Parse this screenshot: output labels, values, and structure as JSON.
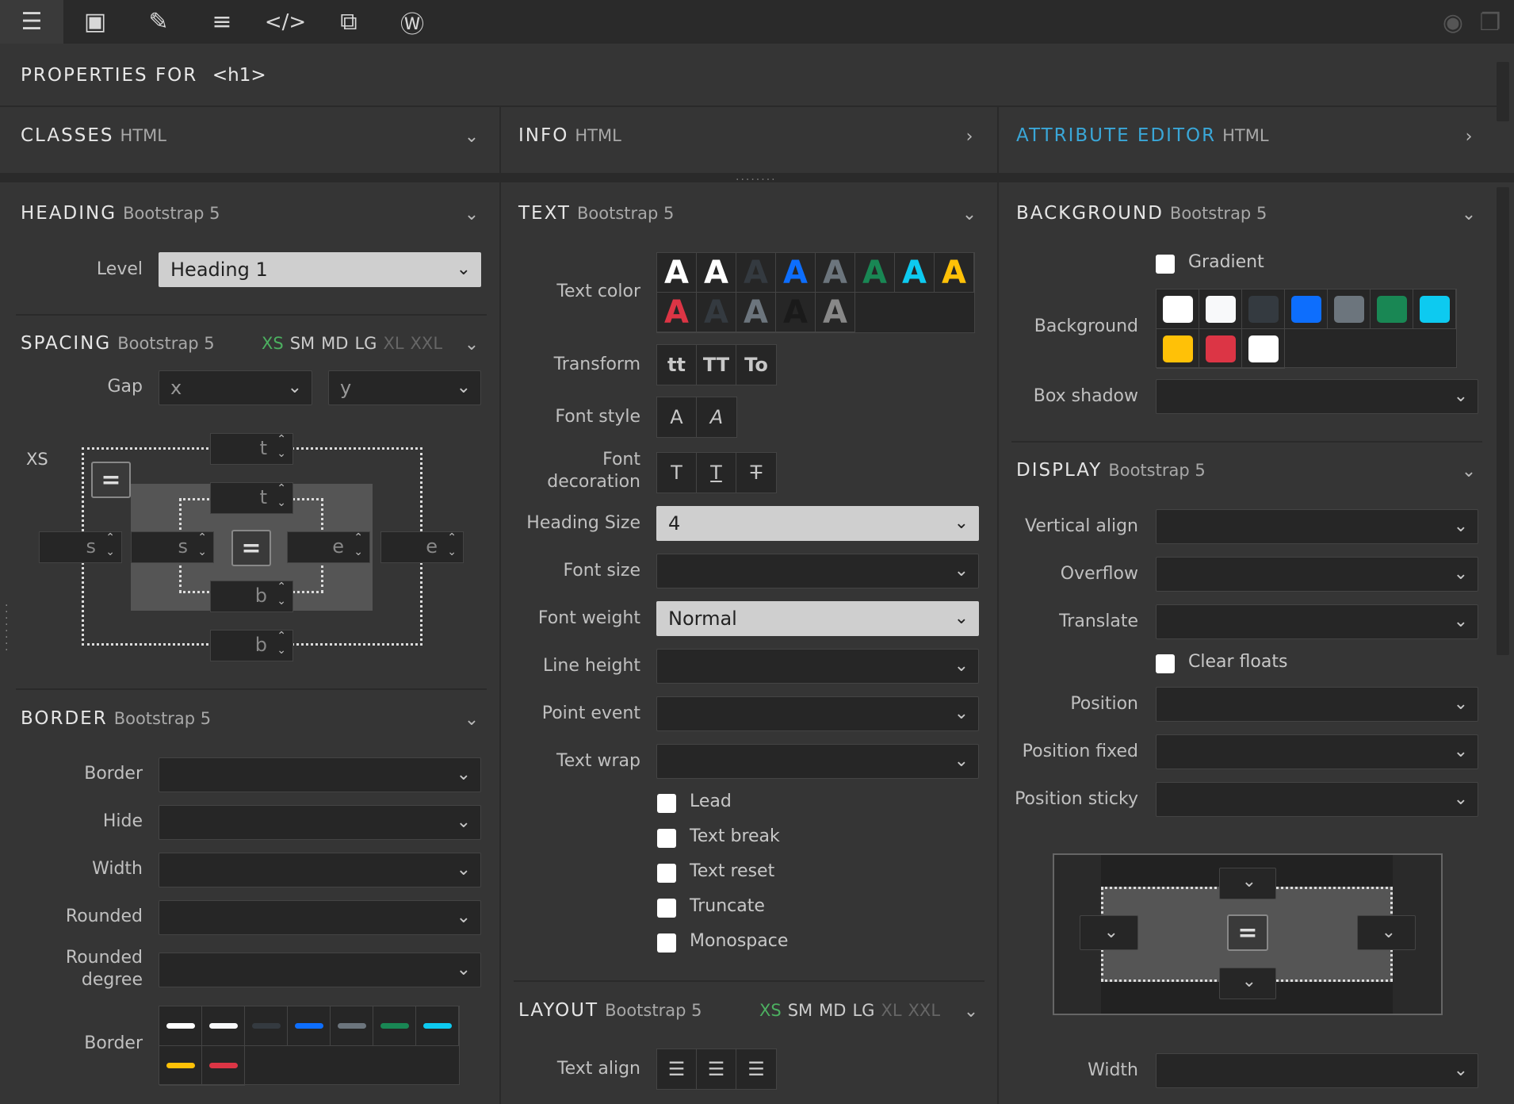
{
  "toolbar": {
    "icons": [
      "sliders-icon",
      "component-icon",
      "brush-icon",
      "list-icon",
      "code-icon",
      "puzzle-icon",
      "wordpress-icon"
    ],
    "right_icons": [
      "eye-icon",
      "window-icon"
    ]
  },
  "header": {
    "title": "PROPERTIES FOR",
    "tag": "<h1>"
  },
  "panels": {
    "classes": {
      "title": "CLASSES",
      "sub": "HTML"
    },
    "info": {
      "title": "INFO",
      "sub": "HTML"
    },
    "attribute_editor": {
      "title": "ATTRIBUTE EDITOR",
      "sub": "HTML"
    }
  },
  "heading": {
    "title": "HEADING",
    "sub": "Bootstrap 5",
    "level_label": "Level",
    "level_value": "Heading 1"
  },
  "spacing": {
    "title": "SPACING",
    "sub": "Bootstrap 5",
    "breakpoints": [
      "XS",
      "SM",
      "MD",
      "LG",
      "XL",
      "XXL"
    ],
    "gap_label": "Gap",
    "gap_x": "x",
    "gap_y": "y",
    "bp_label": "XS",
    "t": "t",
    "b": "b",
    "s": "s",
    "e": "e"
  },
  "border": {
    "title": "BORDER",
    "sub": "Bootstrap 5",
    "border_label": "Border",
    "hide_label": "Hide",
    "width_label": "Width",
    "rounded_label": "Rounded",
    "rounded_degree_label": "Rounded degree",
    "border_color_label": "Border",
    "colors": [
      "#ffffff",
      "#f8f9fa",
      "#343a40",
      "#0d6efd",
      "#6c757d",
      "#198754",
      "#0dcaf0",
      "#ffc107",
      "#dc3545"
    ]
  },
  "text": {
    "title": "TEXT",
    "sub": "Bootstrap 5",
    "text_color_label": "Text color",
    "glyph": "A",
    "text_colors": [
      "#ffffff",
      "#ffffff",
      "#343a40",
      "#0d6efd",
      "#6c757d",
      "#198754",
      "#0dcaf0",
      "#ffc107",
      "#dc3545",
      "#343a40",
      "#6c757d",
      "#1a1a1a",
      "#888888"
    ],
    "transform_label": "Transform",
    "transforms": [
      "tt",
      "TT",
      "To"
    ],
    "font_style_label": "Font style",
    "font_styles": [
      "A",
      "A"
    ],
    "font_decoration_label": "Font decoration",
    "decorations": [
      "T",
      "T",
      "T"
    ],
    "heading_size_label": "Heading Size",
    "heading_size_value": "4",
    "font_size_label": "Font size",
    "font_weight_label": "Font weight",
    "font_weight_value": "Normal",
    "line_height_label": "Line height",
    "point_event_label": "Point event",
    "text_wrap_label": "Text wrap",
    "checks": [
      "Lead",
      "Text break",
      "Text reset",
      "Truncate",
      "Monospace"
    ]
  },
  "layout": {
    "title": "LAYOUT",
    "sub": "Bootstrap 5",
    "breakpoints": [
      "XS",
      "SM",
      "MD",
      "LG",
      "XL",
      "XXL"
    ],
    "text_align_label": "Text align"
  },
  "background": {
    "title": "BACKGROUND",
    "sub": "Bootstrap 5",
    "gradient_label": "Gradient",
    "background_label": "Background",
    "colors": [
      "#ffffff",
      "#f8f9fa",
      "#343a40",
      "#0d6efd",
      "#6c757d",
      "#198754",
      "#0dcaf0",
      "#ffc107",
      "#dc3545",
      "#ffffff"
    ],
    "box_shadow_label": "Box shadow"
  },
  "display": {
    "title": "DISPLAY",
    "sub": "Bootstrap 5",
    "vertical_align_label": "Vertical align",
    "overflow_label": "Overflow",
    "translate_label": "Translate",
    "clear_floats_label": "Clear floats",
    "position_label": "Position",
    "position_fixed_label": "Position fixed",
    "position_sticky_label": "Position sticky",
    "width_label": "Width"
  }
}
